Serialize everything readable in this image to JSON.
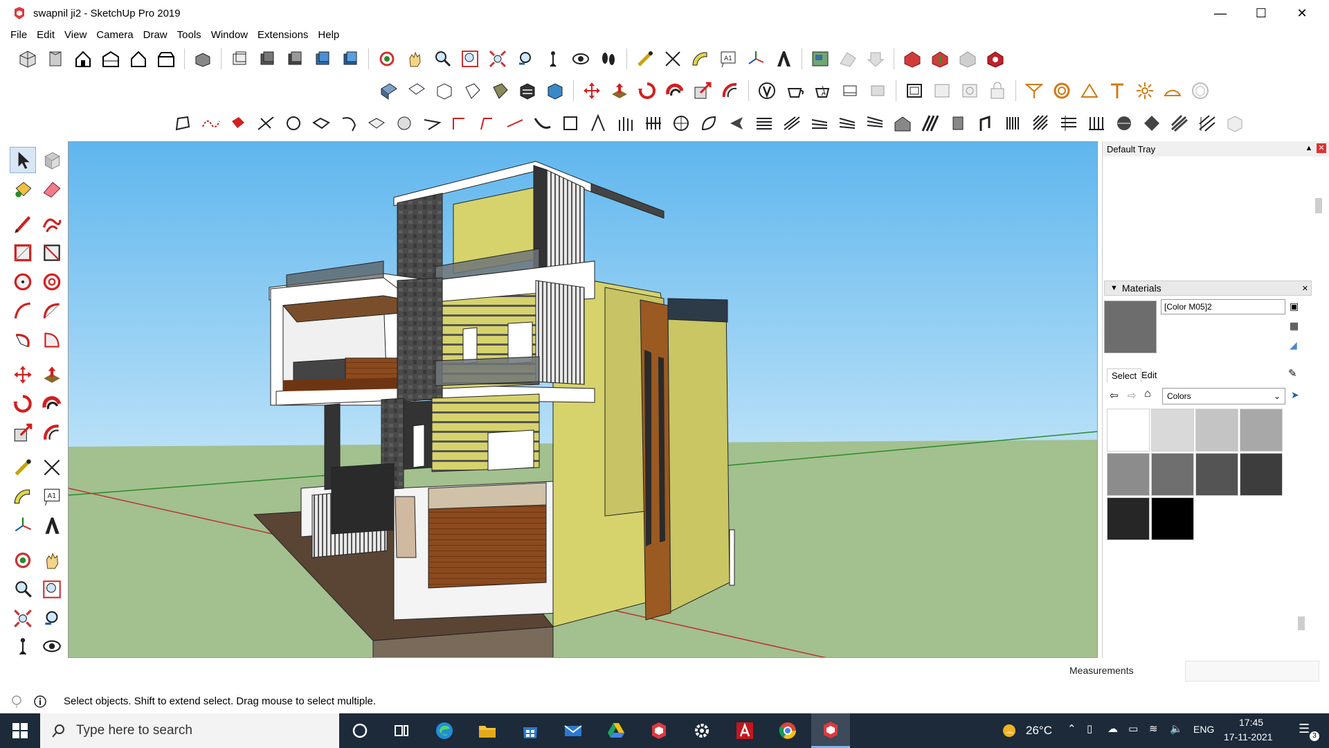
{
  "window": {
    "title": "swapnil ji2 - SketchUp Pro 2019",
    "controls": [
      "minimize",
      "maximize",
      "close"
    ]
  },
  "menu": [
    "File",
    "Edit",
    "View",
    "Camera",
    "Draw",
    "Tools",
    "Window",
    "Extensions",
    "Help"
  ],
  "tray": {
    "title": "Default Tray",
    "materials": {
      "header": "Materials",
      "current_name": "[Color M05]2",
      "current_color": "#6d6d6d",
      "tabs": [
        "Select",
        "Edit"
      ],
      "library": "Colors",
      "swatches": [
        "#ffffff",
        "#d9d9d9",
        "#c4c4c4",
        "#a8a8a8",
        "#8c8c8c",
        "#6f6f6f",
        "#545454",
        "#3d3d3d",
        "#262626",
        "#000000"
      ]
    }
  },
  "measurements": {
    "label": "Measurements"
  },
  "status": {
    "text": "Select objects. Shift to extend select. Drag mouse to select multiple."
  },
  "taskbar": {
    "search_placeholder": "Type here to search",
    "weather": "26°C",
    "language": "ENG",
    "time": "17:45",
    "date": "17-11-2021",
    "notifications": "3"
  },
  "colors": {
    "sky": "#7cc4ee",
    "ground": "#a3c08f",
    "wall_yellow": "#d6d36c",
    "wood": "#8b4a1e",
    "stone": "#4a4a4a"
  }
}
